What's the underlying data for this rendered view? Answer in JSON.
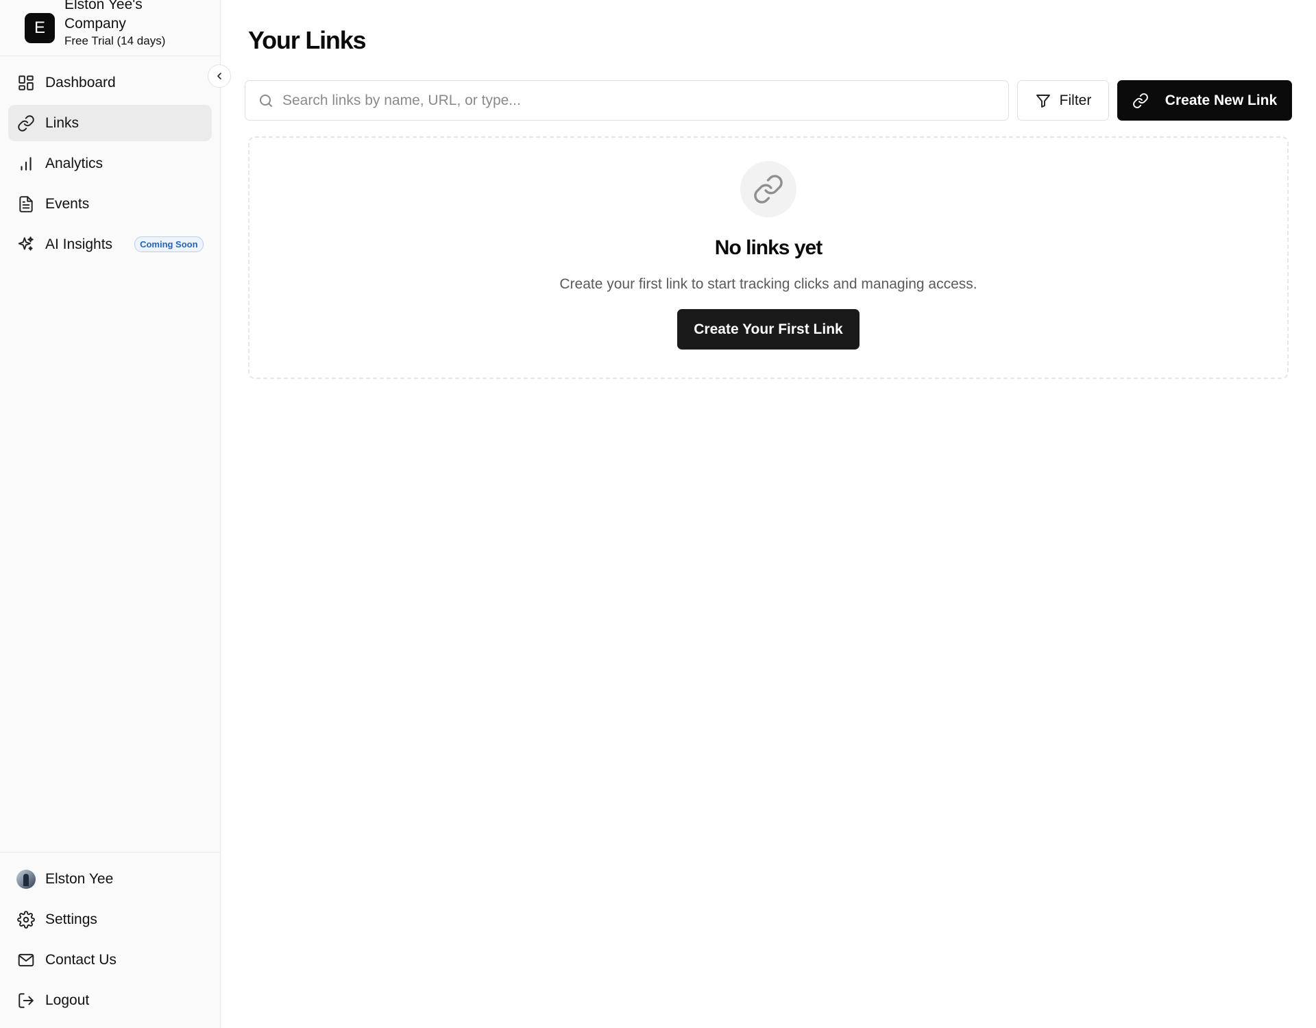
{
  "workspace": {
    "logo_letter": "E",
    "name": "Elston Yee's Company",
    "plan": "Free Trial (14 days)"
  },
  "sidebar": {
    "collapse_icon": "chevron-left-icon",
    "items": [
      {
        "label": "Dashboard",
        "icon": "dashboard-grid-icon",
        "active": false
      },
      {
        "label": "Links",
        "icon": "link-icon",
        "active": true
      },
      {
        "label": "Analytics",
        "icon": "bar-chart-icon",
        "active": false
      },
      {
        "label": "Events",
        "icon": "document-icon",
        "active": false
      },
      {
        "label": "AI Insights",
        "icon": "sparkles-icon",
        "active": false,
        "badge": "Coming Soon"
      }
    ],
    "bottom": [
      {
        "label": "Elston Yee",
        "icon": "avatar"
      },
      {
        "label": "Settings",
        "icon": "gear-icon"
      },
      {
        "label": "Contact Us",
        "icon": "mail-icon"
      },
      {
        "label": "Logout",
        "icon": "logout-icon"
      }
    ]
  },
  "main": {
    "title": "Your Links",
    "search": {
      "placeholder": "Search links by name, URL, or type...",
      "value": ""
    },
    "filter_label": "Filter",
    "create_label": "Create New Link",
    "empty_state": {
      "icon": "link-icon",
      "title": "No links yet",
      "description": "Create your first link to start tracking clicks and managing access.",
      "button_label": "Create Your First Link"
    }
  },
  "colors": {
    "primary": "#0b0b0b",
    "sidebar_bg": "#fafafa",
    "active_item_bg": "#ebebeb",
    "badge_text": "#2563b8",
    "badge_border": "#b7cfee",
    "muted_text": "#5a5a5a"
  }
}
